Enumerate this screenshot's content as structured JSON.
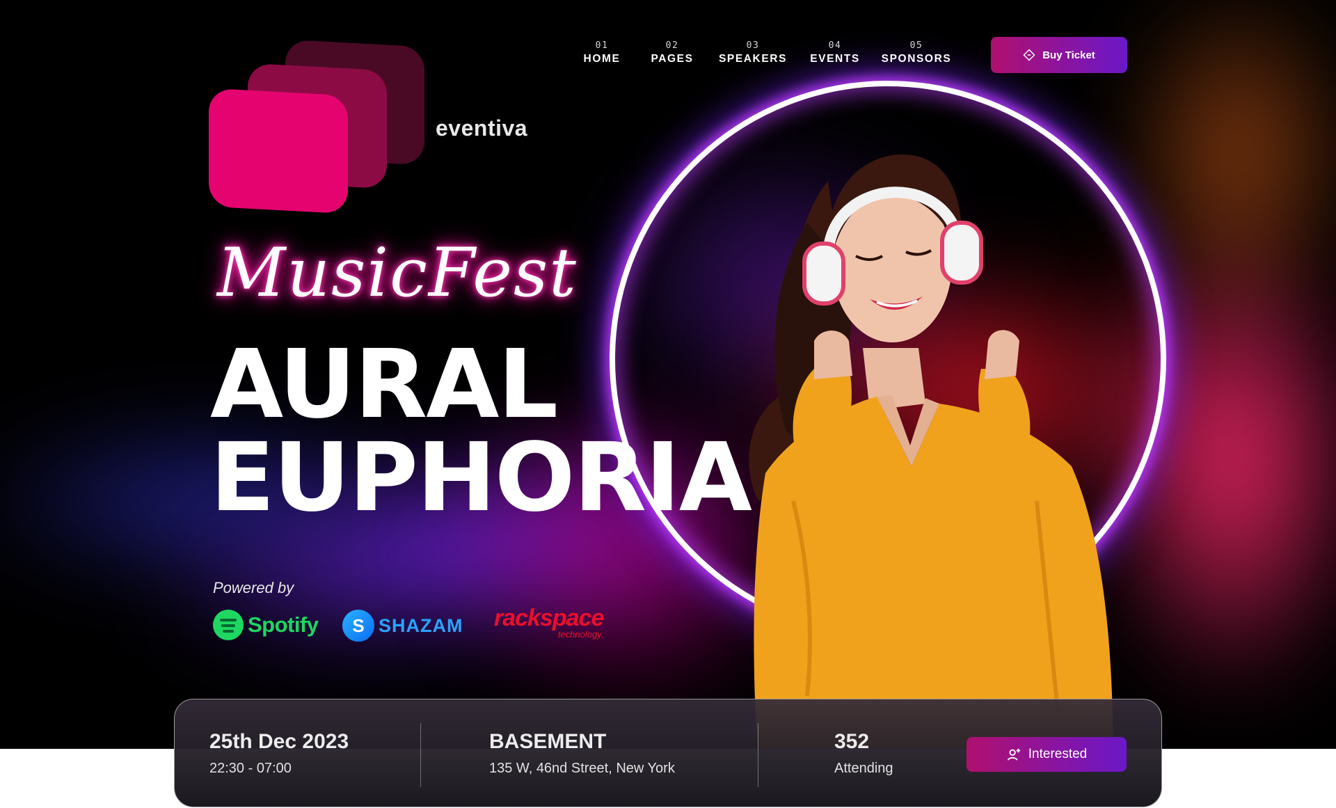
{
  "brand": {
    "name": "eventiva"
  },
  "nav": {
    "items": [
      {
        "num": "01",
        "label": "HOME"
      },
      {
        "num": "02",
        "label": "PAGES"
      },
      {
        "num": "03",
        "label": "SPEAKERS"
      },
      {
        "num": "04",
        "label": "EVENTS"
      },
      {
        "num": "05",
        "label": "SPONSORS"
      }
    ],
    "cta_label": "Buy Ticket",
    "cta_icon": "ticket-icon"
  },
  "hero": {
    "script_title": "MusicFest",
    "title_line1": "AURAL",
    "title_line2": "EUPHORIA",
    "powered_by": "Powered by",
    "sponsors": [
      {
        "name": "Spotify",
        "icon": "spotify-logo"
      },
      {
        "name": "SHAZAM",
        "icon": "shazam-logo"
      },
      {
        "name": "rackspace",
        "sub": "technology.",
        "icon": "rackspace-logo"
      }
    ]
  },
  "event": {
    "date": "25th Dec 2023",
    "time": "22:30 - 07:00",
    "venue": "BASEMENT",
    "address": "135 W, 46nd Street, New York",
    "attending_count": "352",
    "attending_label": "Attending",
    "interested_label": "Interested",
    "interested_icon": "user-plus-icon"
  },
  "colors": {
    "accent_from": "#b0106e",
    "accent_to": "#6a18c8",
    "logo_pink": "#e5046f",
    "spotify_green": "#1ed760",
    "shazam_blue": "#2aa4ff",
    "rackspace_red": "#e8102b"
  }
}
